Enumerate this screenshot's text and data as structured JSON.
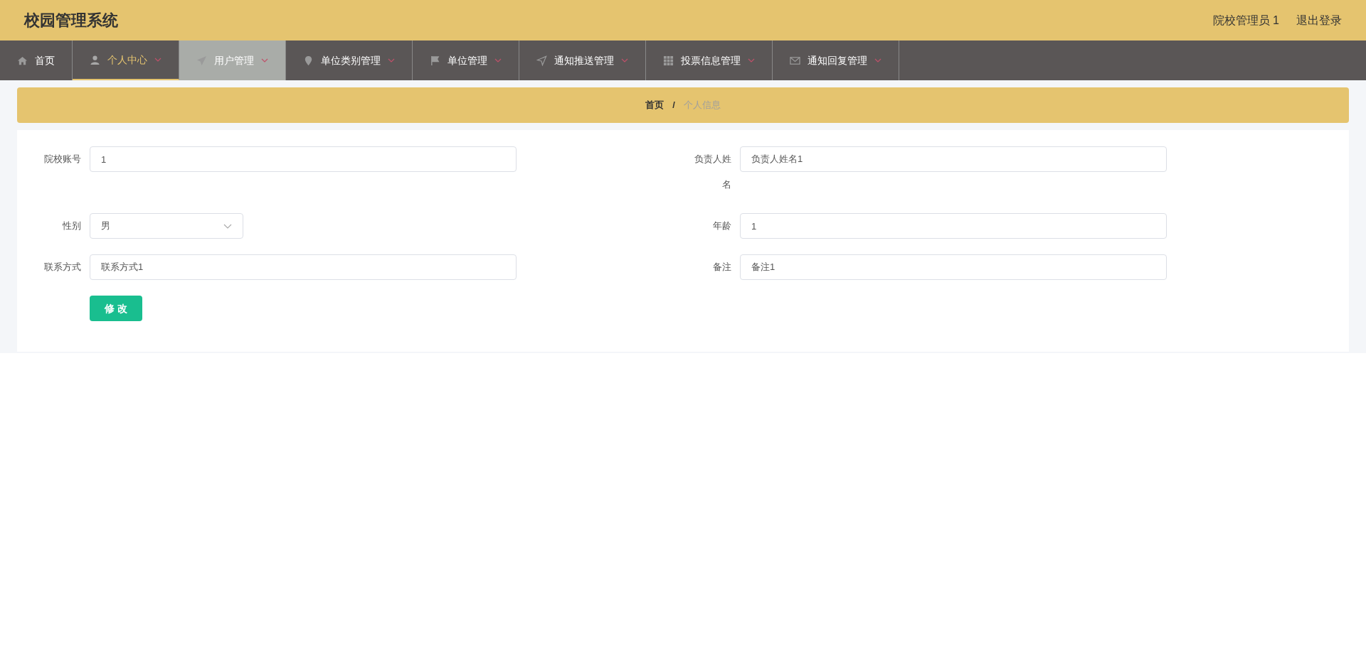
{
  "header": {
    "title": "校园管理系统",
    "user": "院校管理员 1",
    "logout": "退出登录"
  },
  "nav": [
    {
      "label": "首页",
      "kind": "home",
      "has_menu": false,
      "selected": false,
      "highlighted": false
    },
    {
      "label": "个人中心",
      "kind": "user",
      "has_menu": true,
      "selected": true,
      "highlighted": false
    },
    {
      "label": "用户管理",
      "kind": "send",
      "has_menu": true,
      "selected": false,
      "highlighted": true
    },
    {
      "label": "单位类别管理",
      "kind": "pin",
      "has_menu": true,
      "selected": false,
      "highlighted": false
    },
    {
      "label": "单位管理",
      "kind": "flag",
      "has_menu": true,
      "selected": false,
      "highlighted": false
    },
    {
      "label": "通知推送管理",
      "kind": "navigate",
      "has_menu": true,
      "selected": false,
      "highlighted": false
    },
    {
      "label": "投票信息管理",
      "kind": "grid",
      "has_menu": true,
      "selected": false,
      "highlighted": false
    },
    {
      "label": "通知回复管理",
      "kind": "mail",
      "has_menu": true,
      "selected": false,
      "highlighted": false
    }
  ],
  "breadcrumb": [
    "首页",
    "个人信息"
  ],
  "breadcrumb_separator": "/",
  "form": {
    "fields": [
      {
        "label": "院校账号",
        "value": "1",
        "kind": "text"
      },
      {
        "label": "负责人姓名",
        "value": "负责人姓名1",
        "kind": "text"
      },
      {
        "label": "性别",
        "value": "男",
        "kind": "select"
      },
      {
        "label": "年龄",
        "value": "1",
        "kind": "text"
      },
      {
        "label": "联系方式",
        "value": "联系方式1",
        "kind": "text"
      },
      {
        "label": "备注",
        "value": "备注1",
        "kind": "text"
      }
    ],
    "submit": "修 改"
  }
}
